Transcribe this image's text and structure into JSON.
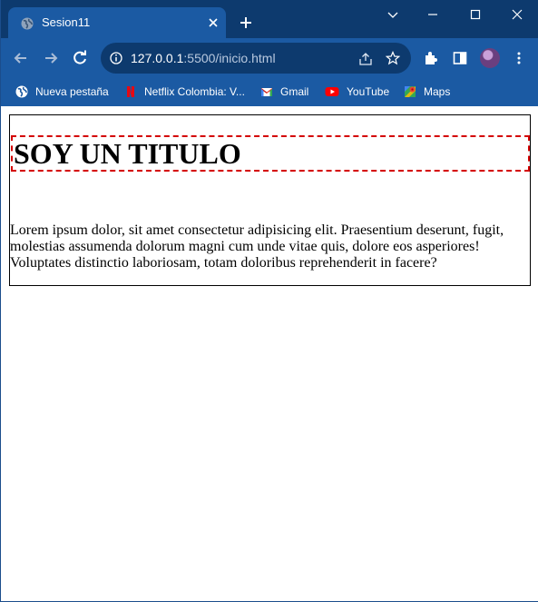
{
  "browser": {
    "tab": {
      "title": "Sesion11"
    },
    "address": {
      "host": "127.0.0.1",
      "path": ":5500/inicio.html"
    },
    "bookmarks": [
      {
        "label": "Nueva pestaña",
        "icon": "globe-icon"
      },
      {
        "label": "Netflix Colombia: V...",
        "icon": "netflix-icon"
      },
      {
        "label": "Gmail",
        "icon": "gmail-icon"
      },
      {
        "label": "YouTube",
        "icon": "youtube-icon"
      },
      {
        "label": "Maps",
        "icon": "maps-icon"
      }
    ],
    "colors": {
      "frame": "#0d3a6e",
      "toolbar": "#1b5aa3",
      "heading_border": "#d40000"
    }
  },
  "page": {
    "heading": "SOY UN TITULO",
    "paragraph": "Lorem ipsum dolor, sit amet consectetur adipisicing elit. Praesentium deserunt, fugit, molestias assumenda dolorum magni cum unde vitae quis, dolore eos asperiores! Voluptates distinctio laboriosam, totam doloribus reprehenderit in facere?"
  }
}
